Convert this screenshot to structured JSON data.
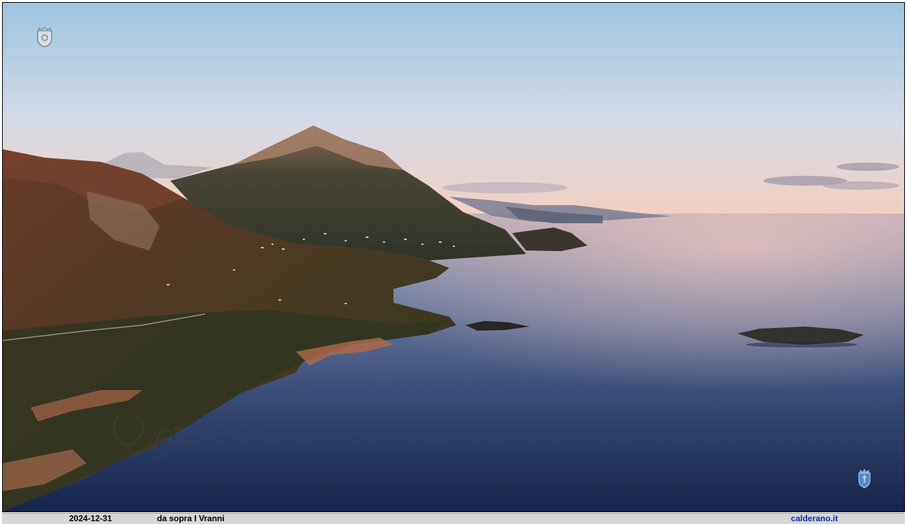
{
  "photo": {
    "subject": "aerial coastal landscape"
  },
  "caption": {
    "date": "2024-12-31",
    "title": "da sopra I Vranni",
    "site": "calderano.it"
  },
  "colors": {
    "sky_top": "#9cc3e0",
    "sky_horizon": "#f0cdbf",
    "sea_far": "#8a8fae",
    "sea_near": "#18284a",
    "caption_bar": "#d6d6d6",
    "site_link": "#0b2bb8"
  },
  "icons": {
    "top_left": "coat-of-arms-icon",
    "bottom_right": "coat-of-arms-icon"
  }
}
